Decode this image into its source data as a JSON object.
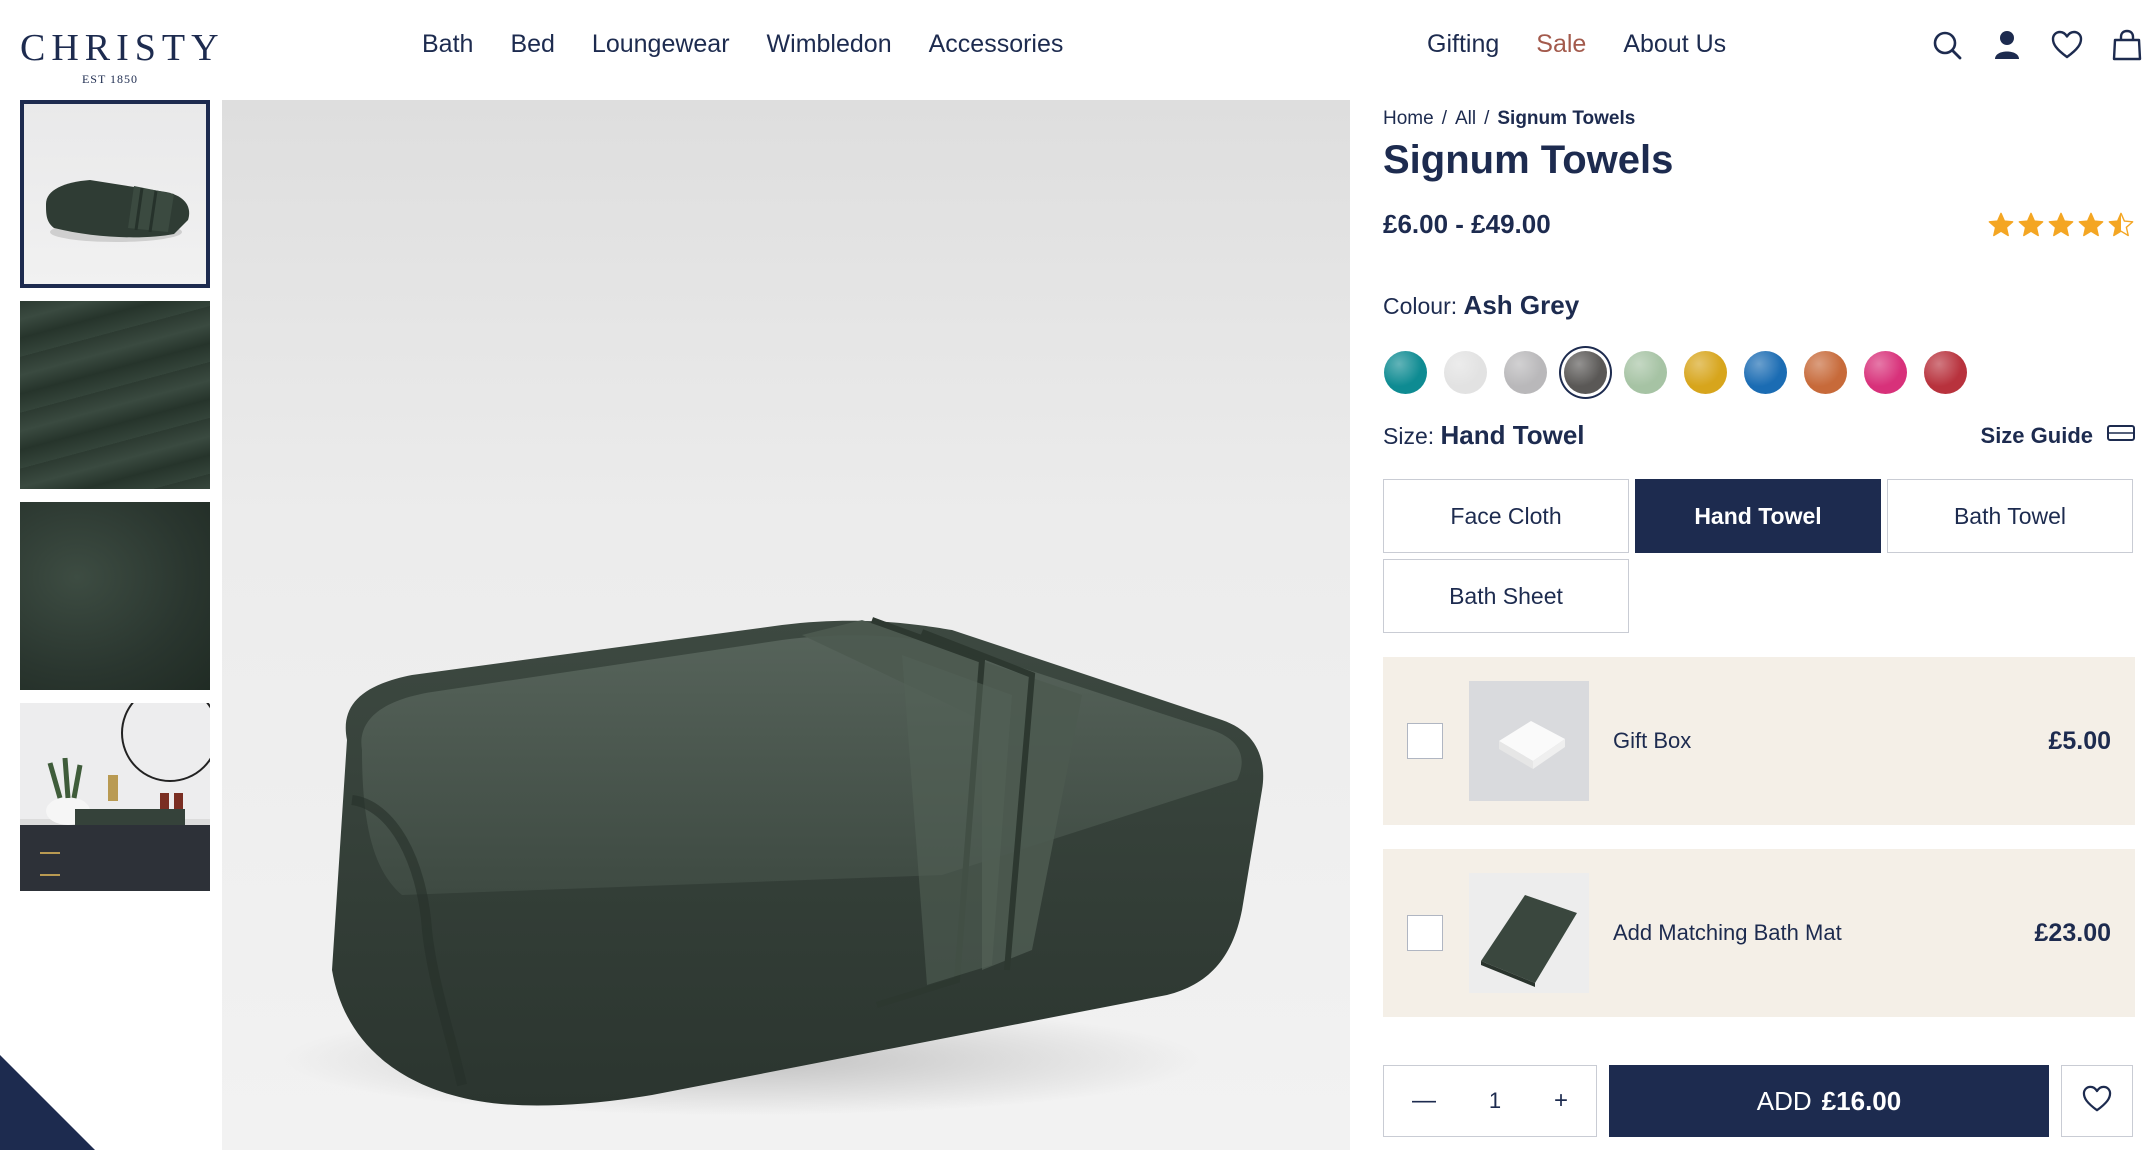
{
  "brand": {
    "name": "CHRISTY",
    "est": "EST 1850"
  },
  "nav_left": [
    "Bath",
    "Bed",
    "Loungewear",
    "Wimbledon",
    "Accessories"
  ],
  "nav_right": [
    "Gifting",
    "Sale",
    "About Us"
  ],
  "header_icons": [
    "search-icon",
    "account-icon",
    "wishlist-heart-icon",
    "shopping-bag-icon"
  ],
  "breadcrumb": {
    "home": "Home",
    "all": "All",
    "current": "Signum Towels",
    "separator": "/"
  },
  "product": {
    "title": "Signum Towels",
    "price_range": "£6.00 - £49.00",
    "rating": 4.5
  },
  "colour": {
    "label": "Colour:",
    "selected": "Ash Grey",
    "swatches": [
      {
        "name": "teal",
        "color": "#0e8b92"
      },
      {
        "name": "white",
        "color": "#e2e2e2"
      },
      {
        "name": "silver",
        "color": "#b9b8ba"
      },
      {
        "name": "ash-grey",
        "color": "#5a5856"
      },
      {
        "name": "sage",
        "color": "#a6c3a4"
      },
      {
        "name": "mustard",
        "color": "#d7a51c"
      },
      {
        "name": "blue",
        "color": "#1b6cb3"
      },
      {
        "name": "rust",
        "color": "#c76a3a"
      },
      {
        "name": "pink",
        "color": "#d8317a"
      },
      {
        "name": "red",
        "color": "#b8323d"
      }
    ]
  },
  "size": {
    "label": "Size:",
    "selected": "Hand Towel",
    "guide_label": "Size Guide",
    "options": [
      "Face Cloth",
      "Hand Towel",
      "Bath Towel",
      "Bath Sheet"
    ]
  },
  "addons": [
    {
      "name": "Gift Box",
      "price": "£5.00"
    },
    {
      "name": "Add Matching Bath Mat",
      "price": "£23.00"
    }
  ],
  "cart": {
    "quantity": "1",
    "minus": "—",
    "plus": "+",
    "add_label": "ADD",
    "add_price": "£16.00"
  },
  "colors": {
    "navy": "#1d2b4f",
    "sale": "#a35a4c",
    "star": "#f4a623",
    "addon_bg": "#f4efe7"
  }
}
